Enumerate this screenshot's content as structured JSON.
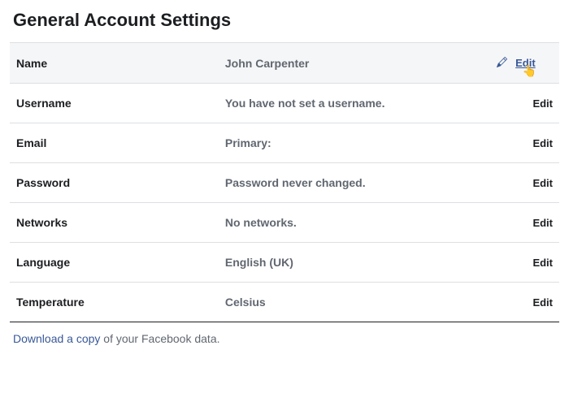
{
  "title": "General Account Settings",
  "edit_label": "Edit",
  "rows": {
    "name": {
      "label": "Name",
      "value": "John Carpenter"
    },
    "username": {
      "label": "Username",
      "value": "You have not set a username."
    },
    "email": {
      "label": "Email",
      "value": "Primary:"
    },
    "password": {
      "label": "Password",
      "value": "Password never changed."
    },
    "networks": {
      "label": "Networks",
      "value": "No networks."
    },
    "language": {
      "label": "Language",
      "value": "English (UK)"
    },
    "temperature": {
      "label": "Temperature",
      "value": "Celsius"
    }
  },
  "download": {
    "link_text": "Download a copy",
    "rest": " of your Facebook data."
  }
}
